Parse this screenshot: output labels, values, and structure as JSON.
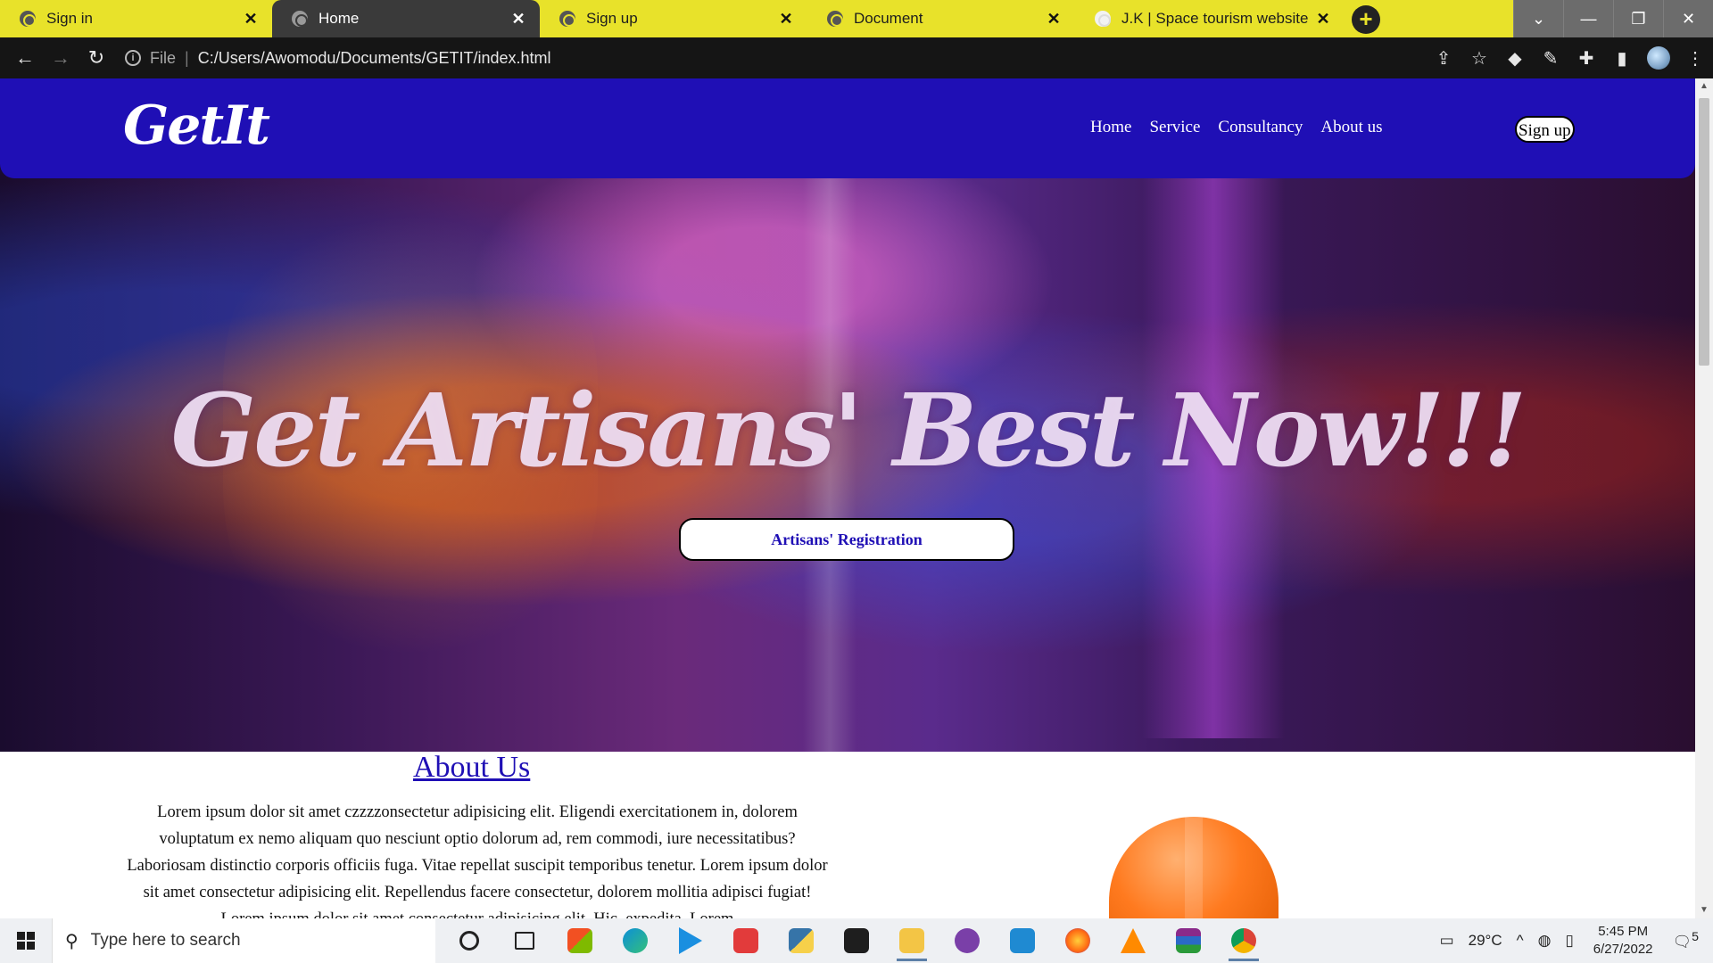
{
  "browser": {
    "tabs": [
      {
        "title": "Sign in",
        "active": false
      },
      {
        "title": "Home",
        "active": true
      },
      {
        "title": "Sign up",
        "active": false
      },
      {
        "title": "Document",
        "active": false
      },
      {
        "title": "J.K | Space tourism website",
        "active": false
      }
    ],
    "address": {
      "scheme": "File",
      "url": "C:/Users/Awomodu/Documents/GETIT/index.html"
    },
    "colors": {
      "tabstrip": "#e8e22a",
      "toolbar": "#151515"
    }
  },
  "site": {
    "logo": "GetIt",
    "nav": [
      "Home",
      "Service",
      "Consultancy",
      "About us"
    ],
    "signup_label": "Sign up",
    "headline": "Get Artisans' Best Now!!!",
    "registration_label": "Artisans' Registration",
    "about": {
      "title": "About Us",
      "text": "Lorem ipsum dolor sit amet czzzzonsectetur adipisicing elit. Eligendi exercitationem in, dolorem voluptatum ex nemo aliquam quo nesciunt optio dolorum ad, rem commodi, iure necessitatibus? Laboriosam distinctio corporis officiis fuga. Vitae repellat suscipit temporibus tenetur. Lorem ipsum dolor sit amet consectetur adipisicing elit. Repellendus facere consectetur, dolorem mollitia adipisci fugiat! Lorem ipsum dolor sit amet consectetur adipisicing elit. Hic, expedita. Lorem"
    },
    "colors": {
      "navbar": "#1f0fb5",
      "accent": "#1f0fb5"
    }
  },
  "taskbar": {
    "search_placeholder": "Type here to search",
    "pinned": [
      "cortana-icon",
      "task-view-icon",
      "store-icon",
      "edge-icon",
      "media-player-icon",
      "gift-icon",
      "python-icon",
      "figma-icon",
      "file-explorer-icon",
      "github-icon",
      "vscode-icon",
      "firefox-icon",
      "vlc-icon",
      "winrar-icon",
      "chrome-icon"
    ],
    "weather": "29°C",
    "time": "5:45 PM",
    "date": "6/27/2022",
    "notification_count": "5"
  }
}
